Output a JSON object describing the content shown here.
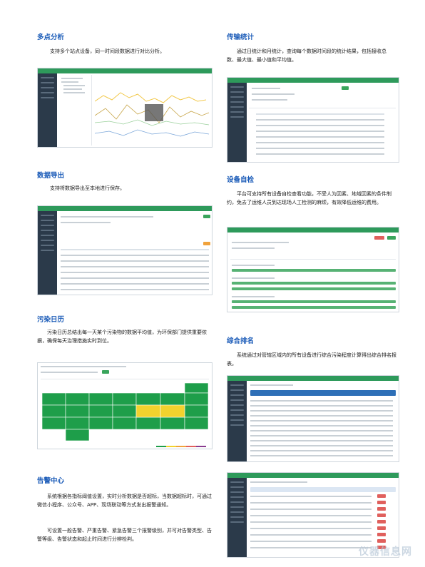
{
  "sections": {
    "multi": {
      "title": "多点分析",
      "text": "支持多个站点设备，同一时间段数据进行对比分析。"
    },
    "transfer": {
      "title": "传输统计",
      "text": "通过日统计和月统计，查询每个数据时间段的统计结果，包括接收总数、最大值、最小值和平均值。"
    },
    "export": {
      "title": "数据导出",
      "text": "支持将数据导出至本地进行保存。"
    },
    "selfcheck": {
      "title": "设备自检",
      "text": "平台可支持所有设备自检查看功能，不受人为因素、地域因素的条件制约，免去了运维人员到达现场人工检测的麻烦，有效降低运维的费用。"
    },
    "calendar": {
      "title": "污染日历",
      "text": "污染日历总结出每一天某个污染物的数据平均值，为环保部门提供重要依据，确保每天治理措施实时到位。"
    },
    "ranking": {
      "title": "综合排名",
      "text": "系统通过对管辖区域内的所有设备进行综合污染程度计算得出综合排名报表。"
    },
    "alarm": {
      "title": "告警中心",
      "text1": "系统根据各指标阈值设置，实时分析数据是否超标，当数据超标时，可通过微信小程序、公众号、APP、现场联动等方式发出报警通知。",
      "text2": "可设置一般告警、严重告警、紧急告警三个报警级别，并可对告警类型、告警等级、告警状态和起止时间进行分辨检判。"
    }
  },
  "watermark": "仪器信息网",
  "colors": {
    "title_blue": "#1a5bb8",
    "green": "#2e9a5b",
    "calendar_green": "#1e9e4a",
    "calendar_yellow": "#f2d22e",
    "alarm_red": "#e0605d"
  }
}
